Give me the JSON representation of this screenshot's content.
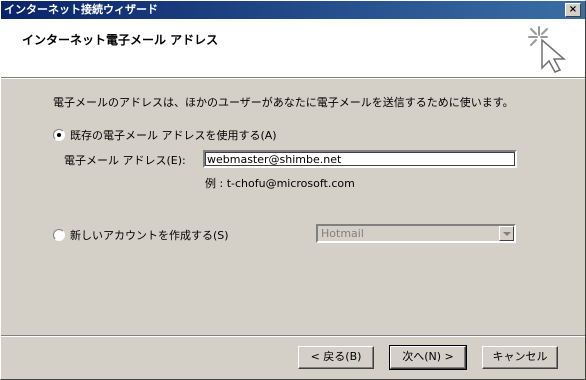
{
  "window": {
    "title": "インターネット接続ウィザード",
    "close_symbol": "×"
  },
  "header": {
    "title": "インターネット電子メール アドレス",
    "icon": "wizard-sparkle-cursor-icon"
  },
  "main": {
    "description": "電子メールのアドレスは、ほかのユーザーがあなたに電子メールを送信するために使います。",
    "use_existing": {
      "label": "既存の電子メール アドレスを使用する(A)",
      "checked": true
    },
    "email_field": {
      "label": "電子メール アドレス(E):",
      "value": "webmaster@shimbe.net"
    },
    "example": "例 : t-chofu@microsoft.com",
    "create_new": {
      "label": "新しいアカウントを作成する(S)",
      "checked": false
    },
    "provider_select": {
      "selected": "Hotmail",
      "enabled": false
    }
  },
  "buttons": {
    "back": "< 戻る(B)",
    "next": "次へ(N) >",
    "cancel": "キャンセル"
  }
}
